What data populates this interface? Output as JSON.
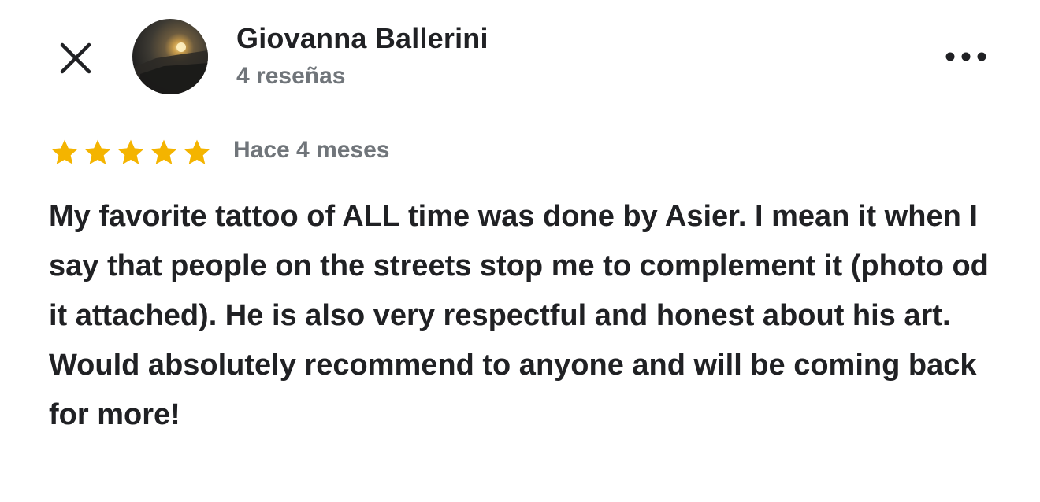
{
  "header": {
    "close_icon": "close-icon",
    "reviewer_name": "Giovanna Ballerini",
    "review_count": "4 reseñas",
    "avatar": "reviewer-photo-avatar",
    "more_icon": "more-horizontal-icon"
  },
  "review": {
    "rating": 5,
    "max_rating": 5,
    "star_color": "#f4b400",
    "date": "Hace 4 meses",
    "text": "My favorite tattoo of ALL time was done by Asier. I mean it when I say that people on the streets stop me to complement it (photo od it attached). He is also very respectful and honest about his art. Would absolutely recommend to anyone and will be coming back for more!"
  }
}
